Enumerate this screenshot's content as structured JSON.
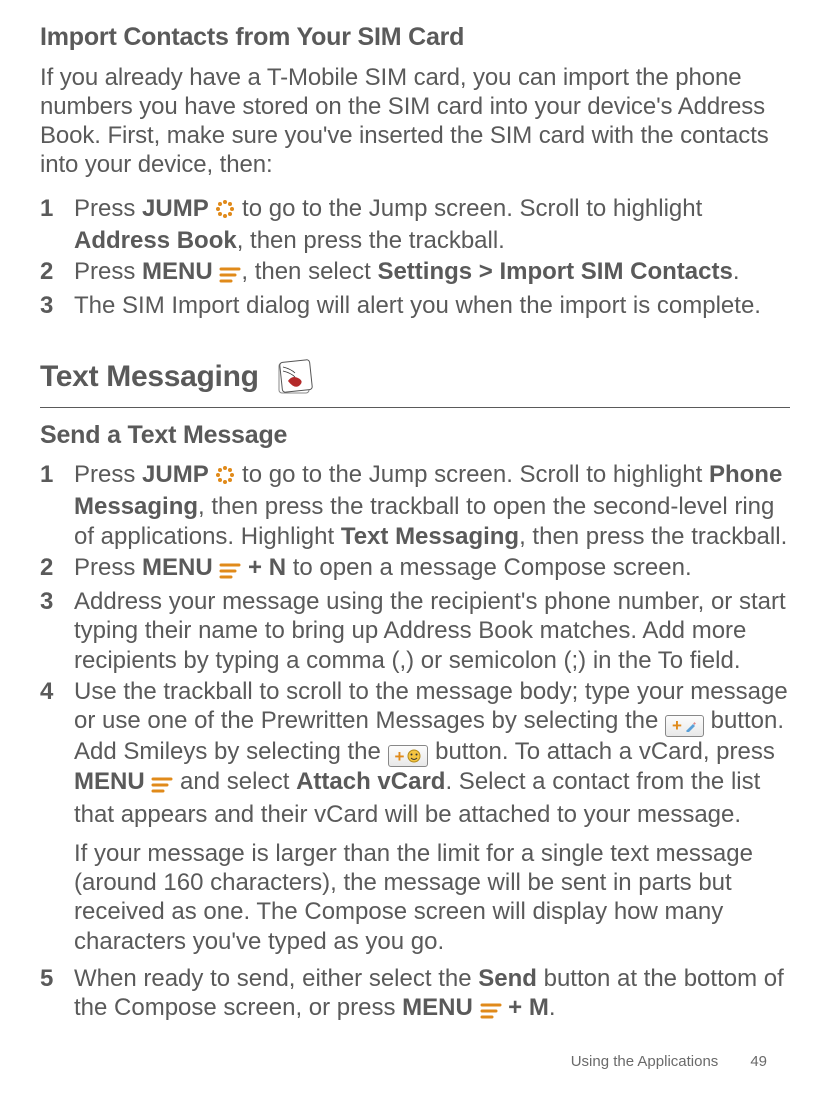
{
  "section1": {
    "title": "Import Contacts from Your SIM Card",
    "intro": "If you already have a T-Mobile SIM card, you can import the phone numbers you have stored on the SIM card into your device's Address Book. First, make sure you've inserted the SIM card with the contacts into your device, then:",
    "steps": {
      "n1": "1",
      "n2": "2",
      "n3": "3",
      "s1a": "Press ",
      "s1_jump": "JUMP",
      "s1b": " to go to the Jump screen. Scroll to highlight ",
      "s1_ab": "Address Book",
      "s1c": ", then press the trackball.",
      "s2a": "Press ",
      "s2_menu": "MENU",
      "s2b": ", then select ",
      "s2_path": "Settings > Import SIM Contacts",
      "s2c": ".",
      "s3": "The SIM Import dialog will alert you when the import is complete."
    }
  },
  "section2": {
    "title": "Text Messaging",
    "subtitle": "Send a Text Message",
    "steps": {
      "n1": "1",
      "n2": "2",
      "n3": "3",
      "n4": "4",
      "n5": "5",
      "s1a": "Press ",
      "s1_jump": "JUMP",
      "s1b": " to go to the Jump screen. Scroll to highlight ",
      "s1_pm": "Phone Messaging",
      "s1c": ", then press the trackball to open the second-level ring of applications. Highlight ",
      "s1_tm": "Text Messaging",
      "s1d": ", then press the trackball.",
      "s2a": "Press ",
      "s2_menu": "MENU",
      "s2_plusn": " + N",
      "s2b": " to open a message Compose screen.",
      "s3": "Address your message using the recipient's phone number, or start typing their name to bring up Address Book matches. Add more recipients by typing a comma (,) or semicolon (;) in the To field.",
      "s4a": "Use the trackball to scroll to the message body; type your message or use one of the Prewritten Messages by selecting the ",
      "s4b": " button. Add Smileys by selecting the ",
      "s4c": " button. To attach a vCard, press ",
      "s4_menu": "MENU",
      "s4d": " and select ",
      "s4_av": "Attach vCard",
      "s4e": ". Select a contact from the list that appears and their vCard will be attached to your message.",
      "s4_note": "If your message is larger than the limit for a single text message (around 160 characters), the message will be sent in parts but received as one. The Compose screen will display how many characters you've typed as you go.",
      "s5a": "When ready to send, either select the ",
      "s5_send": "Send",
      "s5b": " button at the bottom of the Compose screen, or press ",
      "s5_menu": "MENU",
      "s5_plusm": " + M",
      "s5c": "."
    }
  },
  "footer": {
    "section_name": "Using the Applications",
    "page_no": "49"
  }
}
